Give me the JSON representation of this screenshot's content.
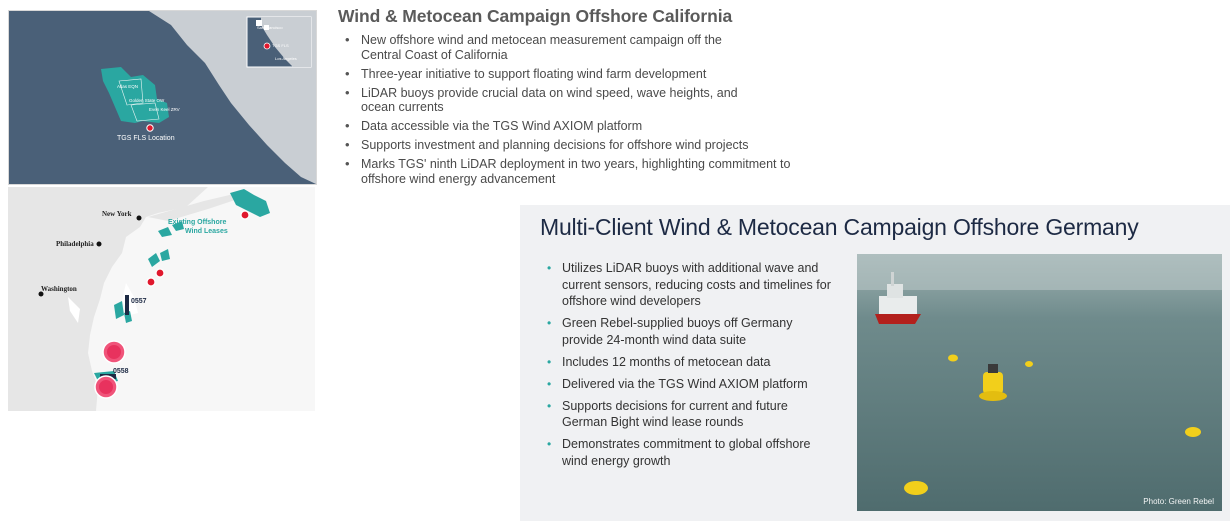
{
  "california": {
    "title": "Wind & Metocean Campaign Offshore California",
    "bullets": [
      "New offshore wind and metocean measurement campaign off the Central Coast of California",
      "Three-year initiative to support floating wind farm development",
      "LiDAR buoys provide crucial data on wind speed, wave heights, and ocean currents",
      "Data accessible via the TGS Wind AXIOM platform",
      "Supports investment and planning decisions for offshore wind projects",
      "Marks TGS' ninth LiDAR deployment in two years, highlighting commitment to offshore wind energy advancement"
    ],
    "map": {
      "location_label": "TGS FLS Location",
      "lease_labels": [
        "Atlas EQN",
        "Golden State OW",
        "Even Keel ZRV"
      ],
      "inset_labels": [
        "San Francisco",
        "TGS FLS",
        "Los Angeles"
      ],
      "colors": {
        "ocean": "#4a6078",
        "land": "#c9ced3",
        "lease": "#2aa7a1",
        "marker": "#e0182d"
      }
    }
  },
  "east_coast_map": {
    "cities": [
      "New York",
      "Philadelphia",
      "Washington"
    ],
    "lease_label_line1": "Existing Offshore",
    "lease_label_line2": "Wind Leases",
    "area_codes": [
      "0557",
      "0558"
    ],
    "colors": {
      "land": "#e6e6e6",
      "water": "#f7f7f7",
      "lease": "#2aa7a1",
      "marker": "#e0182d",
      "big_marker": "#f0547a"
    }
  },
  "germany": {
    "title": "Multi-Client Wind & Metocean Campaign Offshore Germany",
    "bullets": [
      "Utilizes LiDAR buoys with additional wave and current sensors, reducing costs and timelines for offshore wind developers",
      "Green Rebel-supplied buoys off Germany provide 24-month wind data suite",
      "Includes 12 months of metocean data",
      "Delivered via the TGS Wind AXIOM platform",
      "Supports decisions for current and future German Bight wind lease rounds",
      "Demonstrates commitment to global offshore wind energy growth"
    ],
    "photo_credit": "Photo: Green Rebel",
    "colors": {
      "panel_bg": "#f0f1f3",
      "title": "#1d2a44",
      "bullet": "#2aa7a1",
      "sea": "#5f7c7e",
      "buoy": "#f2cf1b"
    }
  }
}
